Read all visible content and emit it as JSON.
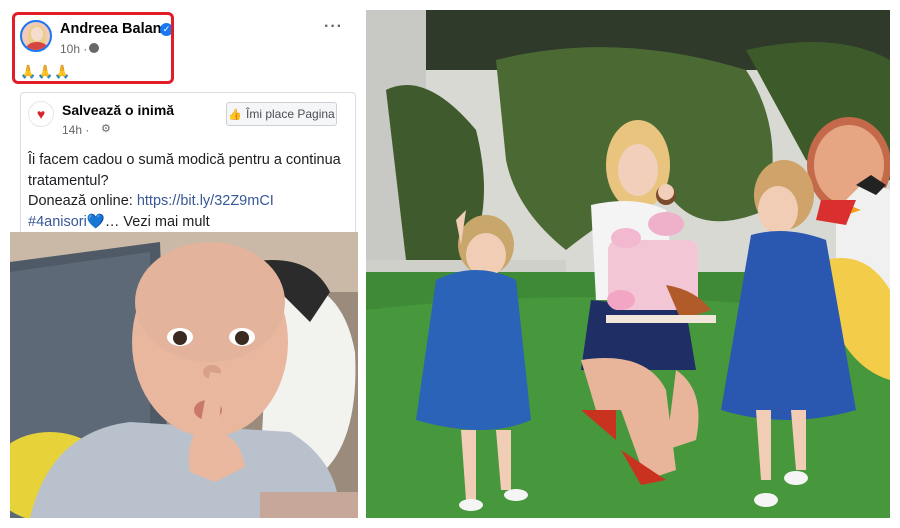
{
  "post": {
    "author": "Andreea Balan",
    "time": "10h ·",
    "emojis": "🙏🙏🙏",
    "more": "···"
  },
  "shared_post": {
    "page_name": "Salvează o inimă",
    "time": "14h ·",
    "like_button": "Îmi place Pagina",
    "text_line1": "Îi facem cadou o sumă modică pentru a continua tratamentul?",
    "text_line2_prefix": "Donează online: ",
    "link": "https://bit.ly/32Z9mCI",
    "hashtag": "#4anisori",
    "see_more": "… Vezi mai mult"
  },
  "colors": {
    "highlight": "#e11d2a",
    "facebook_blue": "#1877f2",
    "link": "#385898"
  }
}
